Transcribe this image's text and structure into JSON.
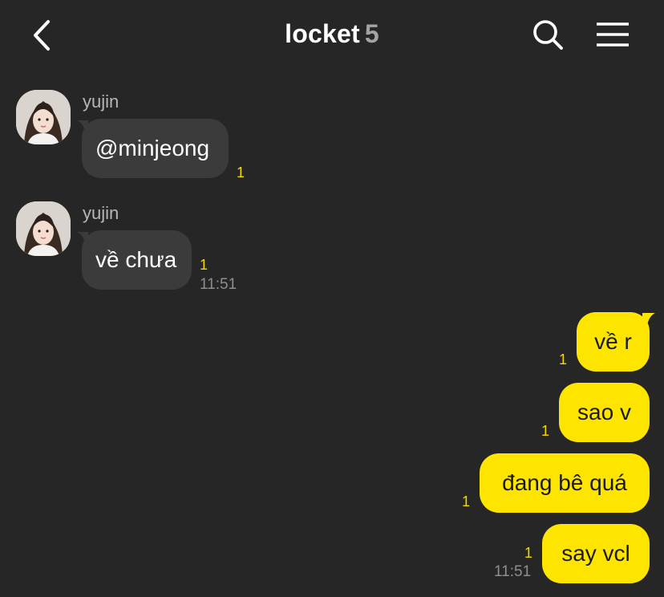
{
  "header": {
    "title": "locket",
    "member_count": "5",
    "icons": {
      "back": "chevron-left-icon",
      "search": "search-icon",
      "menu": "hamburger-menu-icon"
    }
  },
  "colors": {
    "background": "#262626",
    "incoming_bubble": "#3b3b3b",
    "outgoing_bubble": "#fee500",
    "unread": "#f5d800",
    "sender_name": "#b7b7b7",
    "time": "#8e8e8e"
  },
  "messages": {
    "incoming": [
      {
        "sender": "yujin",
        "text": "@minjeong",
        "unread": "1",
        "time": ""
      },
      {
        "sender": "yujin",
        "text": "về chưa",
        "unread": "1",
        "time": "11:51"
      }
    ],
    "outgoing": [
      {
        "text": "về r",
        "unread": "1",
        "time": ""
      },
      {
        "text": "sao v",
        "unread": "1",
        "time": ""
      },
      {
        "text": "đang bê quá",
        "unread": "1",
        "time": ""
      },
      {
        "text": "say vcl",
        "unread": "1",
        "time": "11:51"
      }
    ]
  }
}
